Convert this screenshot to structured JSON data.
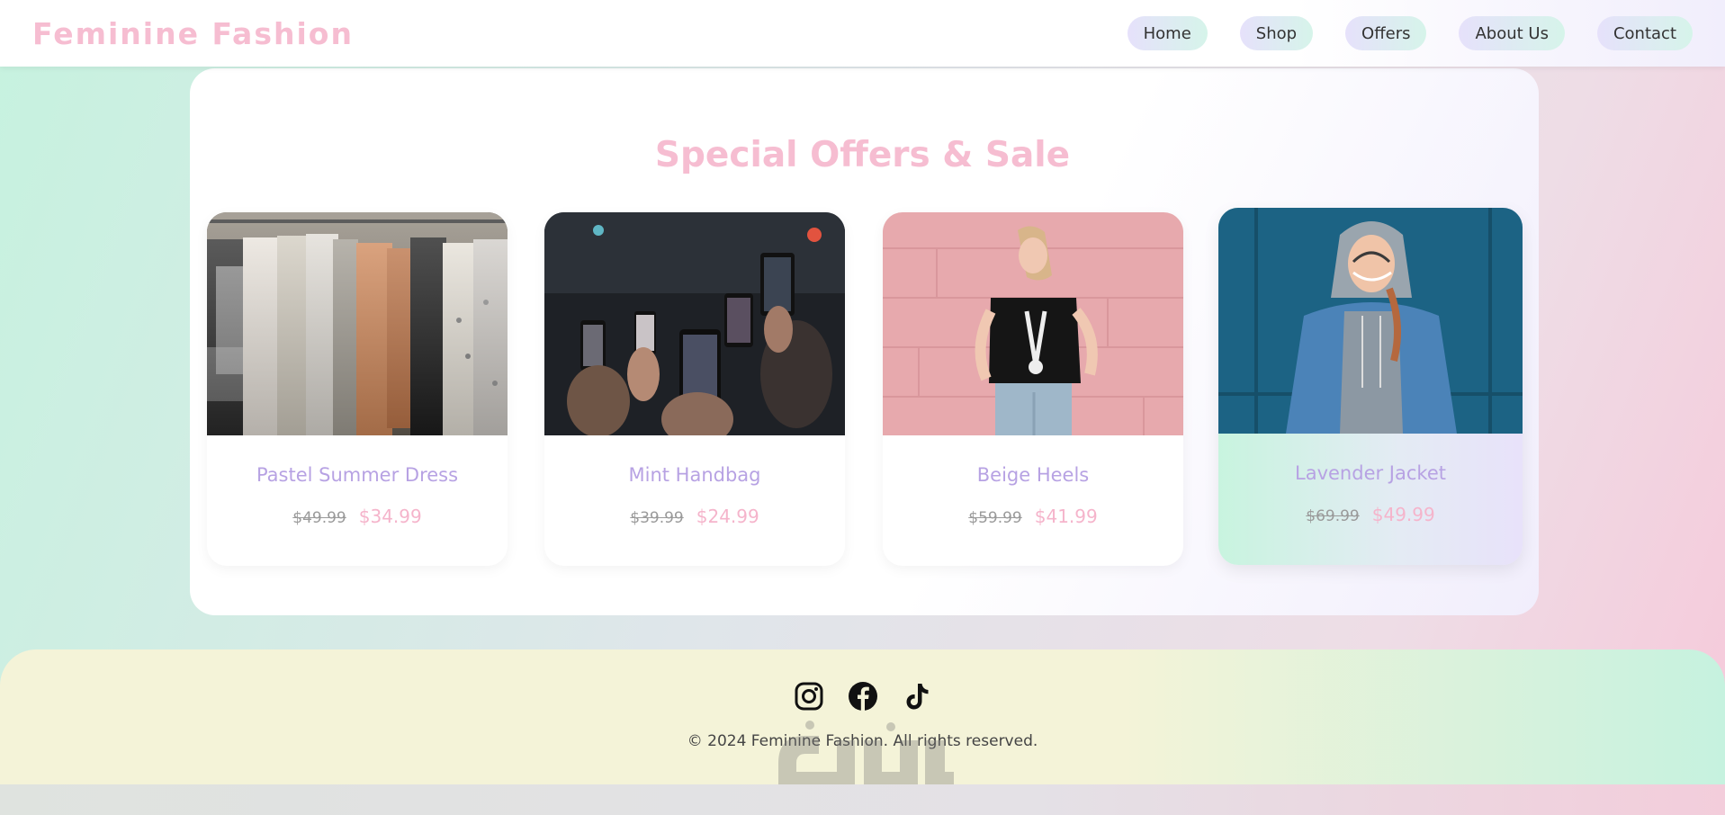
{
  "header": {
    "logo": "Feminine Fashion",
    "nav": [
      "Home",
      "Shop",
      "Offers",
      "About Us",
      "Contact"
    ]
  },
  "main": {
    "title": "Special Offers & Sale",
    "products": [
      {
        "name": "Pastel Summer Dress",
        "old_price": "$49.99",
        "new_price": "$34.99",
        "image": "clothing-rack-photo"
      },
      {
        "name": "Mint Handbag",
        "old_price": "$39.99",
        "new_price": "$24.99",
        "image": "concert-phones-photo"
      },
      {
        "name": "Beige Heels",
        "old_price": "$59.99",
        "new_price": "$41.99",
        "image": "woman-pink-wall-photo"
      },
      {
        "name": "Lavender Jacket",
        "old_price": "$69.99",
        "new_price": "$49.99",
        "image": "woman-denim-jacket-photo"
      }
    ]
  },
  "footer": {
    "icons": [
      "instagram-icon",
      "facebook-icon",
      "tiktok-icon"
    ],
    "copyright": "© 2024 Feminine Fashion. All rights reserved."
  },
  "colors": {
    "accent_pink": "#f6bdd1",
    "price_pink": "#f5b4cb",
    "lavender_text": "#b7a2e3",
    "mint": "#c6f2df"
  }
}
